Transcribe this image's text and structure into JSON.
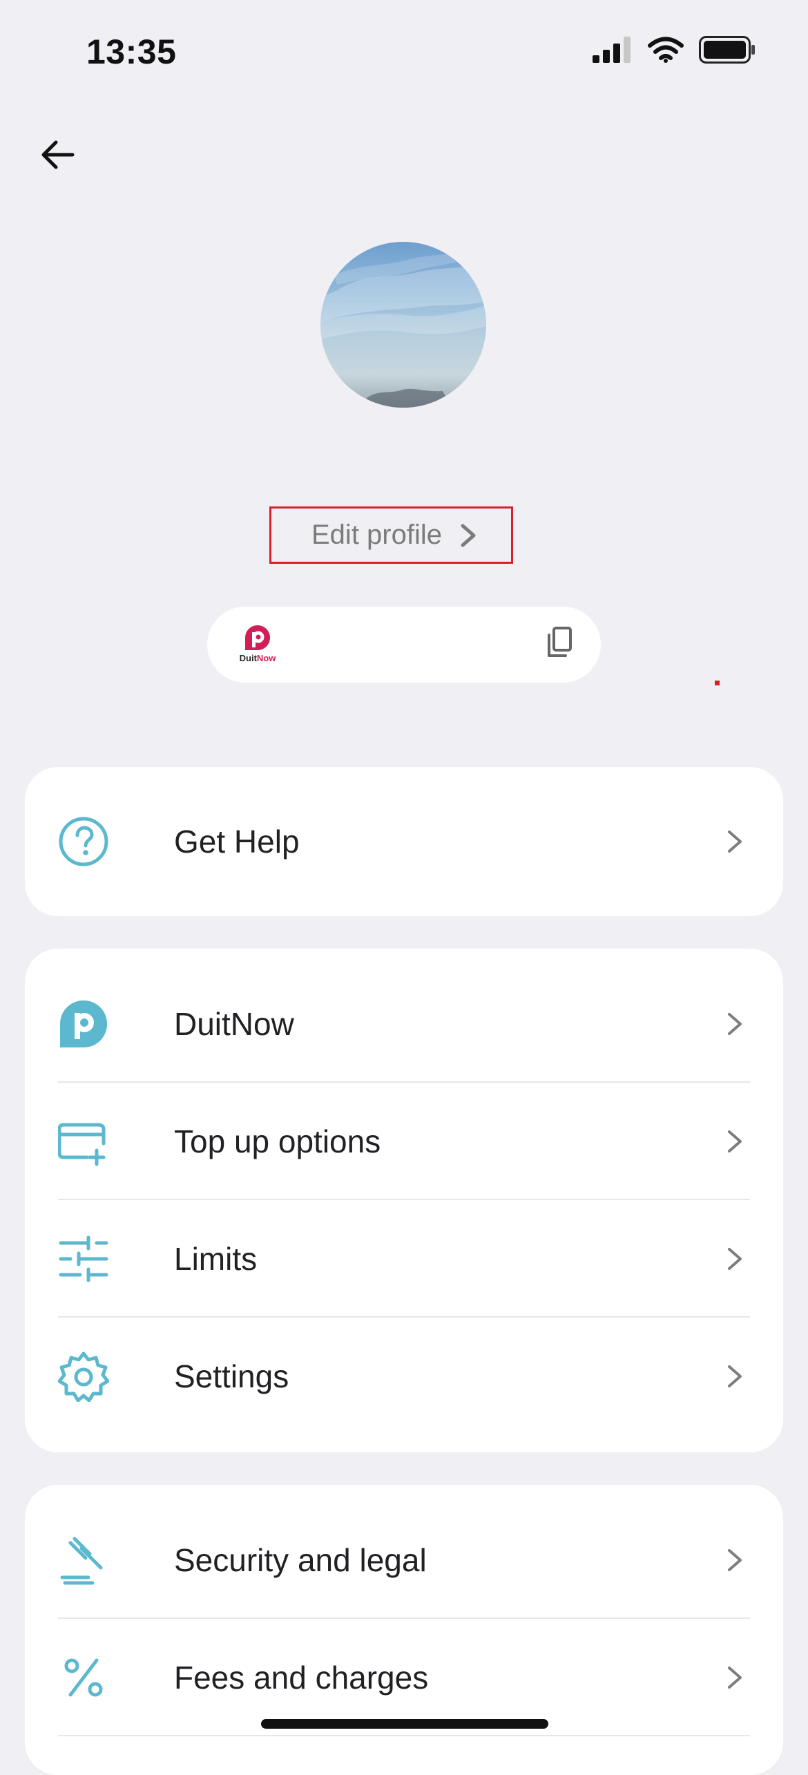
{
  "status_bar": {
    "time": "13:35",
    "signal_icon": "cellular-signal-icon",
    "wifi_icon": "wifi-icon",
    "battery_icon": "battery-icon"
  },
  "header": {
    "back_icon": "back-arrow-icon"
  },
  "profile": {
    "edit_label": "Edit profile",
    "edit_icon": "chevron-right-icon"
  },
  "duitnow_pill": {
    "logo_text_part1": "Duit",
    "logo_text_part2": "Now",
    "copy_icon": "copy-icon"
  },
  "menu_groups": [
    {
      "items": [
        {
          "label": "Get Help",
          "icon": "help-icon"
        }
      ]
    },
    {
      "items": [
        {
          "label": "DuitNow",
          "icon": "duitnow-icon"
        },
        {
          "label": "Top up options",
          "icon": "card-add-icon"
        },
        {
          "label": "Limits",
          "icon": "sliders-icon"
        },
        {
          "label": "Settings",
          "icon": "gear-icon"
        }
      ]
    },
    {
      "items": [
        {
          "label": "Security and legal",
          "icon": "gavel-icon"
        },
        {
          "label": "Fees and charges",
          "icon": "percent-icon"
        }
      ]
    }
  ],
  "colors": {
    "accent": "#5bb8ce",
    "background": "#efeff4",
    "card": "#ffffff",
    "highlight": "#d6202a",
    "duitnow_red": "#d21e57"
  }
}
